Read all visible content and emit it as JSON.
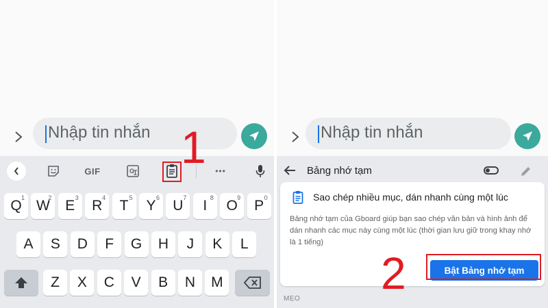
{
  "left": {
    "message_placeholder": "Nhập tin nhắn",
    "toolbar": {
      "gif_label": "GIF",
      "more_label": "•••"
    },
    "keys": {
      "row1": [
        {
          "letter": "Q",
          "num": "1"
        },
        {
          "letter": "W",
          "num": "2"
        },
        {
          "letter": "E",
          "num": "3"
        },
        {
          "letter": "R",
          "num": "4"
        },
        {
          "letter": "T",
          "num": "5"
        },
        {
          "letter": "Y",
          "num": "6"
        },
        {
          "letter": "U",
          "num": "7"
        },
        {
          "letter": "I",
          "num": "8"
        },
        {
          "letter": "O",
          "num": "9"
        },
        {
          "letter": "P",
          "num": "0"
        }
      ],
      "row2": [
        "A",
        "S",
        "D",
        "F",
        "G",
        "H",
        "J",
        "K",
        "L"
      ],
      "row3": [
        "Z",
        "X",
        "C",
        "V",
        "B",
        "N",
        "M"
      ]
    },
    "step_number": "1"
  },
  "right": {
    "message_placeholder": "Nhập tin nhắn",
    "header_title": "Bảng nhớ tạm",
    "card_title": "Sao chép nhiều mục, dán nhanh cùng một lúc",
    "card_description": "Bảng nhớ tạm của Gboard giúp bạn sao chép văn bản và hình ảnh để dán nhanh các mục này cùng một lúc (thời gian lưu giữ trong khay nhớ là 1 tiếng)",
    "enable_button": "Bật Bảng nhớ tạm",
    "tips_label": "MẸO",
    "step_number": "2"
  },
  "colors": {
    "accent_blue": "#1a73e8",
    "send_teal": "#3ba99c",
    "highlight_red": "#e01b24"
  }
}
